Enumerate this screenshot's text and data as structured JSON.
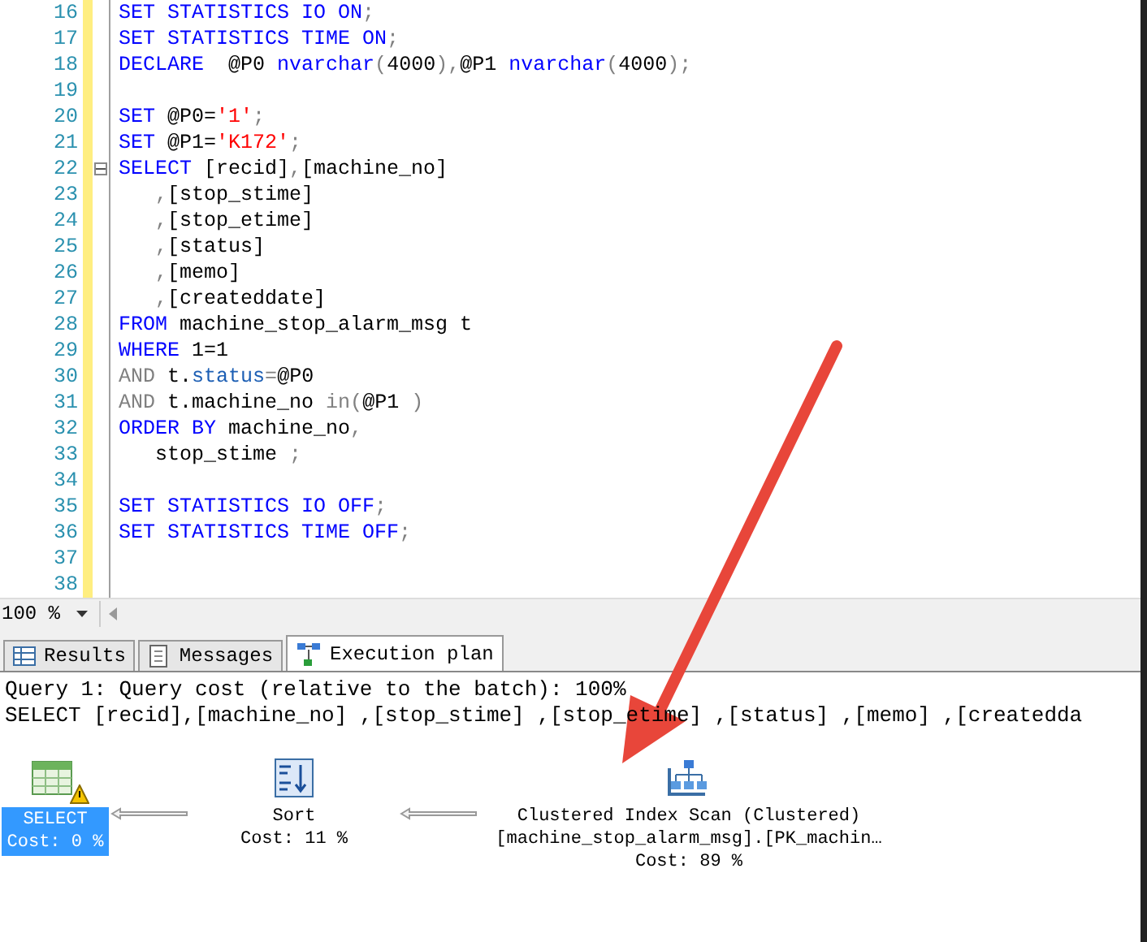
{
  "editor": {
    "lines": [
      {
        "number": "16",
        "fold": false,
        "tokens": [
          {
            "kind": "kw",
            "text": "SET STATISTICS IO ON"
          },
          {
            "kind": "op",
            "text": ";"
          }
        ]
      },
      {
        "number": "17",
        "fold": false,
        "tokens": [
          {
            "kind": "kw",
            "text": "SET STATISTICS TIME ON"
          },
          {
            "kind": "op",
            "text": ";"
          }
        ]
      },
      {
        "number": "18",
        "fold": false,
        "tokens": [
          {
            "kind": "kw",
            "text": "DECLARE"
          },
          {
            "kind": "id",
            "text": "  @P0 "
          },
          {
            "kind": "kw",
            "text": "nvarchar"
          },
          {
            "kind": "op",
            "text": "("
          },
          {
            "kind": "id",
            "text": "4000"
          },
          {
            "kind": "op",
            "text": "),"
          },
          {
            "kind": "id",
            "text": "@P1 "
          },
          {
            "kind": "kw",
            "text": "nvarchar"
          },
          {
            "kind": "op",
            "text": "("
          },
          {
            "kind": "id",
            "text": "4000"
          },
          {
            "kind": "op",
            "text": ");"
          }
        ]
      },
      {
        "number": "19",
        "fold": false
      },
      {
        "number": "20",
        "fold": false,
        "tokens": [
          {
            "kind": "kw",
            "text": "SET"
          },
          {
            "kind": "id",
            "text": " @P0="
          },
          {
            "kind": "str",
            "text": "'1'"
          },
          {
            "kind": "op",
            "text": ";"
          }
        ]
      },
      {
        "number": "21",
        "fold": false,
        "tokens": [
          {
            "kind": "kw",
            "text": "SET"
          },
          {
            "kind": "id",
            "text": " @P1="
          },
          {
            "kind": "str",
            "text": "'K172'"
          },
          {
            "kind": "op",
            "text": ";"
          }
        ]
      },
      {
        "number": "22",
        "fold": true,
        "tokens": [
          {
            "kind": "kw",
            "text": "SELECT"
          },
          {
            "kind": "id",
            "text": " [recid]"
          },
          {
            "kind": "op",
            "text": ","
          },
          {
            "kind": "id",
            "text": "[machine_no]"
          }
        ]
      },
      {
        "number": "23",
        "fold": false,
        "tokens": [
          {
            "kind": "op",
            "text": "   ,"
          },
          {
            "kind": "id",
            "text": "[stop_stime]"
          }
        ]
      },
      {
        "number": "24",
        "fold": false,
        "tokens": [
          {
            "kind": "op",
            "text": "   ,"
          },
          {
            "kind": "id",
            "text": "[stop_etime]"
          }
        ]
      },
      {
        "number": "25",
        "fold": false,
        "tokens": [
          {
            "kind": "op",
            "text": "   ,"
          },
          {
            "kind": "id",
            "text": "[status]"
          }
        ]
      },
      {
        "number": "26",
        "fold": false,
        "tokens": [
          {
            "kind": "op",
            "text": "   ,"
          },
          {
            "kind": "id",
            "text": "[memo]"
          }
        ]
      },
      {
        "number": "27",
        "fold": false,
        "tokens": [
          {
            "kind": "op",
            "text": "   ,"
          },
          {
            "kind": "id",
            "text": "[createddate]"
          }
        ]
      },
      {
        "number": "28",
        "fold": false,
        "tokens": [
          {
            "kind": "kw",
            "text": "FROM"
          },
          {
            "kind": "id",
            "text": " machine_stop_alarm_msg t"
          }
        ]
      },
      {
        "number": "29",
        "fold": false,
        "tokens": [
          {
            "kind": "kw",
            "text": "WHERE"
          },
          {
            "kind": "id",
            "text": " 1=1"
          }
        ]
      },
      {
        "number": "30",
        "fold": false,
        "tokens": [
          {
            "kind": "op",
            "text": "AND"
          },
          {
            "kind": "id",
            "text": " t."
          },
          {
            "kind": "sys",
            "text": "status"
          },
          {
            "kind": "op",
            "text": "="
          },
          {
            "kind": "id",
            "text": "@P0"
          }
        ]
      },
      {
        "number": "31",
        "fold": false,
        "tokens": [
          {
            "kind": "op",
            "text": "AND"
          },
          {
            "kind": "id",
            "text": " t.machine_no "
          },
          {
            "kind": "op",
            "text": "in("
          },
          {
            "kind": "id",
            "text": "@P1 "
          },
          {
            "kind": "op",
            "text": ")"
          }
        ]
      },
      {
        "number": "32",
        "fold": false,
        "tokens": [
          {
            "kind": "kw",
            "text": "ORDER BY"
          },
          {
            "kind": "id",
            "text": " machine_no"
          },
          {
            "kind": "op",
            "text": ","
          }
        ]
      },
      {
        "number": "33",
        "fold": false,
        "tokens": [
          {
            "kind": "id",
            "text": "   stop_stime "
          },
          {
            "kind": "op",
            "text": ";"
          }
        ]
      },
      {
        "number": "34",
        "fold": false
      },
      {
        "number": "35",
        "fold": false,
        "tokens": [
          {
            "kind": "kw",
            "text": "SET STATISTICS IO OFF"
          },
          {
            "kind": "op",
            "text": ";"
          }
        ]
      },
      {
        "number": "36",
        "fold": false,
        "tokens": [
          {
            "kind": "kw",
            "text": "SET STATISTICS TIME OFF"
          },
          {
            "kind": "op",
            "text": ";"
          }
        ]
      },
      {
        "number": "37",
        "fold": false
      },
      {
        "number": "38",
        "fold": false
      }
    ]
  },
  "zoom": {
    "value": "100 %"
  },
  "tabs": [
    {
      "label": "Results",
      "kind": "grid",
      "selected": false
    },
    {
      "label": "Messages",
      "kind": "messages",
      "selected": false
    },
    {
      "label": "Execution plan",
      "kind": "plan",
      "selected": true
    }
  ],
  "plan": {
    "header": [
      "Query 1: Query cost (relative to the batch): 100%",
      "SELECT [recid],[machine_no] ,[stop_stime] ,[stop_etime] ,[status] ,[memo] ,[createdda"
    ],
    "nodes": [
      {
        "kind": "select",
        "selected": true,
        "warning": true,
        "lines": [
          "SELECT",
          "Cost: 0 %"
        ]
      },
      {
        "kind": "sort",
        "selected": false,
        "warning": false,
        "lines": [
          "Sort",
          "Cost: 11 %"
        ]
      },
      {
        "kind": "scan",
        "selected": false,
        "warning": false,
        "lines": [
          "Clustered Index Scan (Clustered)",
          "[machine_stop_alarm_msg].[PK_machin…",
          "Cost: 89 %"
        ]
      }
    ]
  }
}
